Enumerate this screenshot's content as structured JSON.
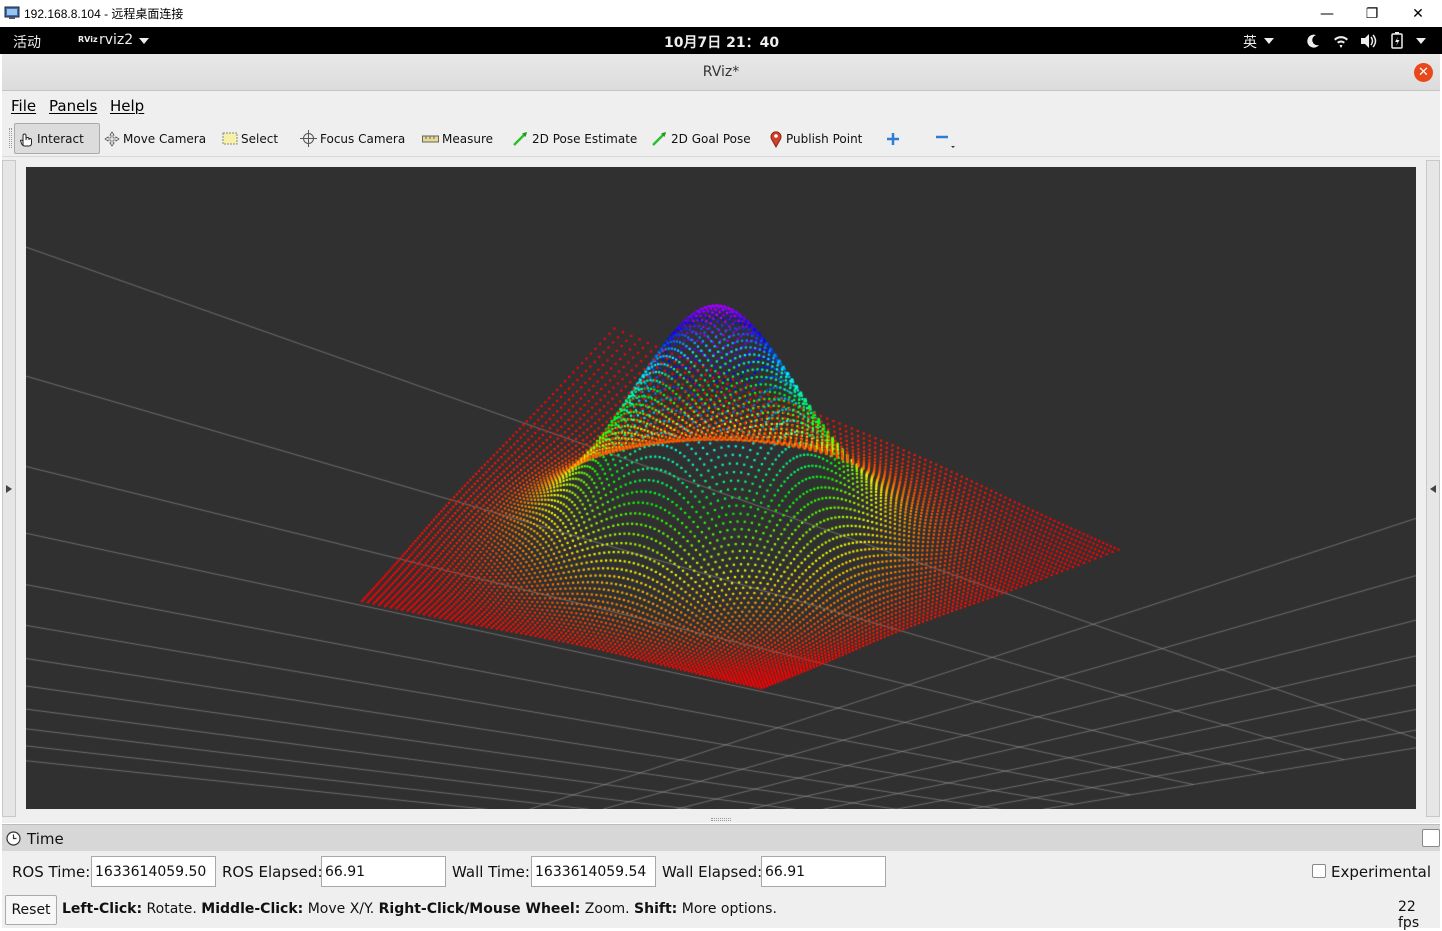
{
  "rdp": {
    "title": "192.168.8.104 - 远程桌面连接",
    "minimize": "—",
    "restore": "❐",
    "close": "✕"
  },
  "gnome": {
    "activities": "活动",
    "app_icon_text": "RViz",
    "app_name": "rviz2",
    "clock": "10月7日  21：40",
    "input_method": "英"
  },
  "window": {
    "title": "RViz*",
    "close": "✕"
  },
  "menu": [
    "File",
    "Panels",
    "Help"
  ],
  "toolbar": {
    "interact": "Interact",
    "move_camera": "Move Camera",
    "select": "Select",
    "focus_camera": "Focus Camera",
    "measure": "Measure",
    "pose_estimate": "2D Pose Estimate",
    "goal_pose": "2D Goal Pose",
    "publish_point": "Publish Point"
  },
  "time_panel": {
    "title": "Time",
    "ros_time_label": "ROS Time:",
    "ros_time": "1633614059.50",
    "ros_elapsed_label": "ROS Elapsed:",
    "ros_elapsed": "66.91",
    "wall_time_label": "Wall Time:",
    "wall_time": "1633614059.54",
    "wall_elapsed_label": "Wall Elapsed:",
    "wall_elapsed": "66.91",
    "experimental_label": "Experimental",
    "experimental_checked": false
  },
  "status": {
    "reset_label": "Reset",
    "hint_1_bold": "Left-Click:",
    "hint_1": "Rotate.",
    "hint_2_bold": "Middle-Click:",
    "hint_2": "Move X/Y.",
    "hint_3_bold": "Right-Click/Mouse Wheel:",
    "hint_3": "Zoom.",
    "hint_4_bold": "Shift:",
    "hint_4": "More options.",
    "fps": "22 fps"
  },
  "scene": {
    "background_color": "#303030",
    "grid_color": "#a0a0a0",
    "point_cloud": "gaussian surface, rainbow colored by height"
  }
}
